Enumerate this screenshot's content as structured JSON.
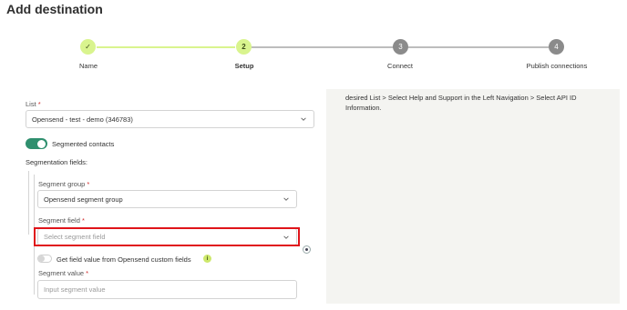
{
  "page": {
    "title": "Add destination"
  },
  "stepper": {
    "steps": [
      {
        "number": "✓",
        "label": "Name"
      },
      {
        "number": "2",
        "label": "Setup"
      },
      {
        "number": "3",
        "label": "Connect"
      },
      {
        "number": "4",
        "label": "Publish connections"
      }
    ]
  },
  "form": {
    "list": {
      "label": "List",
      "required_mark": "*",
      "value": "Opensend - test - demo (346783)"
    },
    "segmented": {
      "label": "Segmented contacts",
      "enabled": true
    },
    "segmentation_fields_label": "Segmentation fields:",
    "segment_group": {
      "label": "Segment group",
      "required_mark": "*",
      "value": "Opensend segment group"
    },
    "segment_field": {
      "label": "Segment field",
      "required_mark": "*",
      "placeholder": "Select segment field"
    },
    "custom_fields_toggle": {
      "label": "Get field value from Opensend custom fields",
      "enabled": false,
      "info_icon": "i"
    },
    "segment_value": {
      "label": "Segment value",
      "required_mark": "*",
      "placeholder": "Input segment value"
    }
  },
  "info_panel": {
    "text": "desired List > Select Help and Support in the Left Navigation > Select API ID Information."
  },
  "colors": {
    "accent_green": "#2f8f6e",
    "step_active": "#d9f48e",
    "highlight_red": "#e0141a"
  }
}
